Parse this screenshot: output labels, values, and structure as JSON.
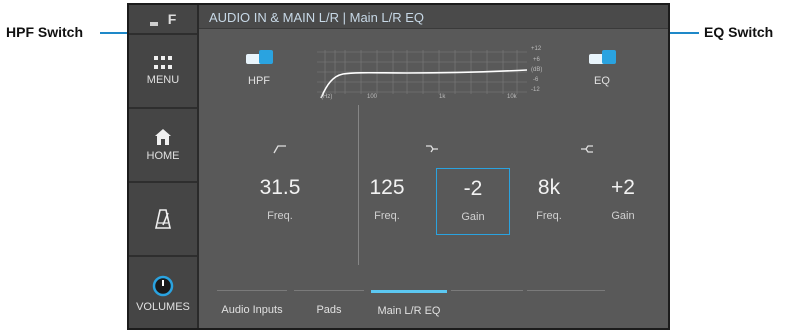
{
  "callouts": {
    "hpf": "HPF Switch",
    "eq": "EQ Switch"
  },
  "sidebar": {
    "logo_letter": "F",
    "items": [
      {
        "label": "MENU",
        "icon": "grid-icon"
      },
      {
        "label": "HOME",
        "icon": "home-icon"
      },
      {
        "label": "",
        "icon": "metronome-icon"
      },
      {
        "label": "VOLUMES",
        "icon": "knob-icon"
      }
    ]
  },
  "header": {
    "title": "AUDIO IN & MAIN L/R | Main L/R EQ"
  },
  "hpf_toggle": {
    "label": "HPF",
    "state": "on"
  },
  "eq_toggle": {
    "label": "EQ",
    "state": "on"
  },
  "graph": {
    "x_labels": [
      "(Hz)",
      "100",
      "1k",
      "10k"
    ],
    "y_labels": [
      "+12",
      "+6",
      "(dB)",
      "-6",
      "-12"
    ]
  },
  "params": {
    "hpf": {
      "value": "31.5",
      "label": "Freq."
    },
    "low_freq": {
      "value": "125",
      "label": "Freq."
    },
    "low_gain": {
      "value": "-2",
      "label": "Gain"
    },
    "high_freq": {
      "value": "8k",
      "label": "Freq."
    },
    "high_gain": {
      "value": "+2",
      "label": "Gain"
    }
  },
  "tabs": [
    {
      "label": "Audio Inputs"
    },
    {
      "label": "Pads"
    },
    {
      "label": "Main L/R EQ",
      "active": true
    }
  ],
  "colors": {
    "accent": "#2aa3e0",
    "callout_line": "#1e88c8",
    "screen_bg": "#595959"
  }
}
